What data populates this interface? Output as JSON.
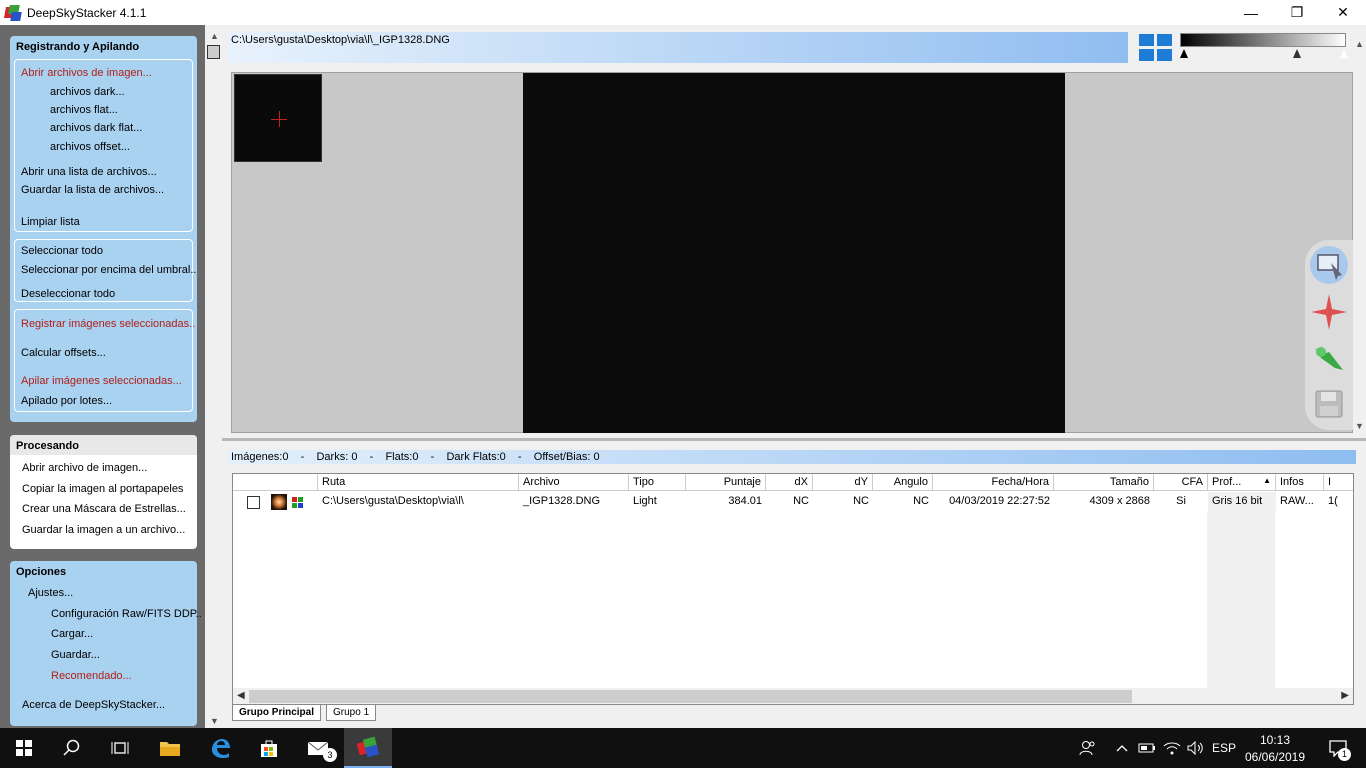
{
  "window": {
    "title": "DeepSkyStacker 4.1.1",
    "minimize": "—",
    "restore": "❐",
    "close": "✕"
  },
  "left": {
    "register": {
      "title": "Registrando y Apilando",
      "open_images": "Abrir archivos de imagen...",
      "darks": "archivos dark...",
      "flats": "archivos flat...",
      "dark_flats": "archivos dark flat...",
      "offsets": "archivos offset...",
      "open_list": "Abrir una lista de archivos...",
      "save_list": "Guardar la lista de archivos...",
      "clear_list": "Limpiar lista",
      "select_all": "Seleccionar todo",
      "select_above": "Seleccionar por encima del umbral...",
      "deselect_all": "Deseleccionar todo",
      "register_selected": "Registrar imágenes seleccionadas...",
      "compute_offsets": "Calcular offsets...",
      "stack_selected": "Apilar imágenes seleccionadas...",
      "batch_stack": "Apilado por lotes..."
    },
    "processing": {
      "title": "Procesando",
      "open_image": "Abrir archivo de imagen...",
      "copy_clipboard": "Copiar la imagen al portapapeles",
      "star_mask": "Crear una Máscara de Estrellas...",
      "save_image": "Guardar la imagen a un archivo..."
    },
    "options": {
      "title": "Opciones",
      "settings": "Ajustes...",
      "raw_fits": "Configuración Raw/FITS DDP...",
      "load": "Cargar...",
      "save": "Guardar...",
      "recommended": "Recomendado...",
      "about": "Acerca de DeepSkyStacker..."
    }
  },
  "scroll": {
    "up": "▲",
    "down": "▼",
    "left": "◀",
    "right": "▶"
  },
  "path": "C:\\Users\\gusta\\Desktop\\via\\l\\_IGP1328.DNG",
  "status": {
    "images": "Imágenes:0",
    "sep": "   -   ",
    "darks": "Darks: 0",
    "flats": "Flats:0",
    "dark_flats": "Dark Flats:0",
    "offsets": "Offset/Bias: 0"
  },
  "table": {
    "headers": {
      "ruta": "Ruta",
      "archivo": "Archivo",
      "tipo": "Tipo",
      "puntaje": "Puntaje",
      "dx": "dX",
      "dy": "dY",
      "angulo": "Angulo",
      "fecha": "Fecha/Hora",
      "tamano": "Tamaño",
      "cfa": "CFA",
      "prof": "Prof...",
      "infos": "Infos",
      "iso": "I"
    },
    "row": {
      "ruta": "C:\\Users\\gusta\\Desktop\\via\\l\\",
      "archivo": "_IGP1328.DNG",
      "tipo": "Light",
      "puntaje": "384.01",
      "dx": "NC",
      "dy": "NC",
      "angulo": "NC",
      "fecha": "04/03/2019 22:27:52",
      "tamano": "4309 x 2868",
      "cfa": "Si",
      "prof": "Gris 16 bit",
      "infos": "RAW...",
      "iso": "1("
    }
  },
  "tabs": {
    "main": "Grupo Principal",
    "group1": "Grupo 1"
  },
  "taskbar": {
    "mail_badge": "3",
    "language": "ESP",
    "time": "10:13",
    "date": "06/06/2019",
    "notifications": "1"
  }
}
